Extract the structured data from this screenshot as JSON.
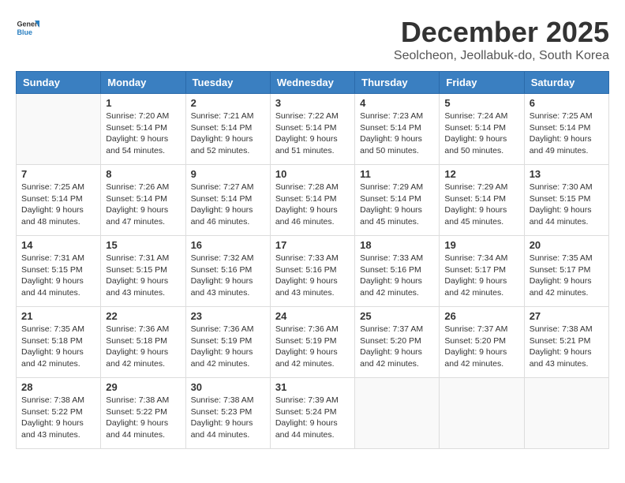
{
  "logo": {
    "general": "General",
    "blue": "Blue"
  },
  "title": "December 2025",
  "subtitle": "Seolcheon, Jeollabuk-do, South Korea",
  "headers": [
    "Sunday",
    "Monday",
    "Tuesday",
    "Wednesday",
    "Thursday",
    "Friday",
    "Saturday"
  ],
  "weeks": [
    [
      {
        "day": "",
        "info": ""
      },
      {
        "day": "1",
        "info": "Sunrise: 7:20 AM\nSunset: 5:14 PM\nDaylight: 9 hours\nand 54 minutes."
      },
      {
        "day": "2",
        "info": "Sunrise: 7:21 AM\nSunset: 5:14 PM\nDaylight: 9 hours\nand 52 minutes."
      },
      {
        "day": "3",
        "info": "Sunrise: 7:22 AM\nSunset: 5:14 PM\nDaylight: 9 hours\nand 51 minutes."
      },
      {
        "day": "4",
        "info": "Sunrise: 7:23 AM\nSunset: 5:14 PM\nDaylight: 9 hours\nand 50 minutes."
      },
      {
        "day": "5",
        "info": "Sunrise: 7:24 AM\nSunset: 5:14 PM\nDaylight: 9 hours\nand 50 minutes."
      },
      {
        "day": "6",
        "info": "Sunrise: 7:25 AM\nSunset: 5:14 PM\nDaylight: 9 hours\nand 49 minutes."
      }
    ],
    [
      {
        "day": "7",
        "info": "Sunrise: 7:25 AM\nSunset: 5:14 PM\nDaylight: 9 hours\nand 48 minutes."
      },
      {
        "day": "8",
        "info": "Sunrise: 7:26 AM\nSunset: 5:14 PM\nDaylight: 9 hours\nand 47 minutes."
      },
      {
        "day": "9",
        "info": "Sunrise: 7:27 AM\nSunset: 5:14 PM\nDaylight: 9 hours\nand 46 minutes."
      },
      {
        "day": "10",
        "info": "Sunrise: 7:28 AM\nSunset: 5:14 PM\nDaylight: 9 hours\nand 46 minutes."
      },
      {
        "day": "11",
        "info": "Sunrise: 7:29 AM\nSunset: 5:14 PM\nDaylight: 9 hours\nand 45 minutes."
      },
      {
        "day": "12",
        "info": "Sunrise: 7:29 AM\nSunset: 5:14 PM\nDaylight: 9 hours\nand 45 minutes."
      },
      {
        "day": "13",
        "info": "Sunrise: 7:30 AM\nSunset: 5:15 PM\nDaylight: 9 hours\nand 44 minutes."
      }
    ],
    [
      {
        "day": "14",
        "info": "Sunrise: 7:31 AM\nSunset: 5:15 PM\nDaylight: 9 hours\nand 44 minutes."
      },
      {
        "day": "15",
        "info": "Sunrise: 7:31 AM\nSunset: 5:15 PM\nDaylight: 9 hours\nand 43 minutes."
      },
      {
        "day": "16",
        "info": "Sunrise: 7:32 AM\nSunset: 5:16 PM\nDaylight: 9 hours\nand 43 minutes."
      },
      {
        "day": "17",
        "info": "Sunrise: 7:33 AM\nSunset: 5:16 PM\nDaylight: 9 hours\nand 43 minutes."
      },
      {
        "day": "18",
        "info": "Sunrise: 7:33 AM\nSunset: 5:16 PM\nDaylight: 9 hours\nand 42 minutes."
      },
      {
        "day": "19",
        "info": "Sunrise: 7:34 AM\nSunset: 5:17 PM\nDaylight: 9 hours\nand 42 minutes."
      },
      {
        "day": "20",
        "info": "Sunrise: 7:35 AM\nSunset: 5:17 PM\nDaylight: 9 hours\nand 42 minutes."
      }
    ],
    [
      {
        "day": "21",
        "info": "Sunrise: 7:35 AM\nSunset: 5:18 PM\nDaylight: 9 hours\nand 42 minutes."
      },
      {
        "day": "22",
        "info": "Sunrise: 7:36 AM\nSunset: 5:18 PM\nDaylight: 9 hours\nand 42 minutes."
      },
      {
        "day": "23",
        "info": "Sunrise: 7:36 AM\nSunset: 5:19 PM\nDaylight: 9 hours\nand 42 minutes."
      },
      {
        "day": "24",
        "info": "Sunrise: 7:36 AM\nSunset: 5:19 PM\nDaylight: 9 hours\nand 42 minutes."
      },
      {
        "day": "25",
        "info": "Sunrise: 7:37 AM\nSunset: 5:20 PM\nDaylight: 9 hours\nand 42 minutes."
      },
      {
        "day": "26",
        "info": "Sunrise: 7:37 AM\nSunset: 5:20 PM\nDaylight: 9 hours\nand 42 minutes."
      },
      {
        "day": "27",
        "info": "Sunrise: 7:38 AM\nSunset: 5:21 PM\nDaylight: 9 hours\nand 43 minutes."
      }
    ],
    [
      {
        "day": "28",
        "info": "Sunrise: 7:38 AM\nSunset: 5:22 PM\nDaylight: 9 hours\nand 43 minutes."
      },
      {
        "day": "29",
        "info": "Sunrise: 7:38 AM\nSunset: 5:22 PM\nDaylight: 9 hours\nand 44 minutes."
      },
      {
        "day": "30",
        "info": "Sunrise: 7:38 AM\nSunset: 5:23 PM\nDaylight: 9 hours\nand 44 minutes."
      },
      {
        "day": "31",
        "info": "Sunrise: 7:39 AM\nSunset: 5:24 PM\nDaylight: 9 hours\nand 44 minutes."
      },
      {
        "day": "",
        "info": ""
      },
      {
        "day": "",
        "info": ""
      },
      {
        "day": "",
        "info": ""
      }
    ]
  ]
}
